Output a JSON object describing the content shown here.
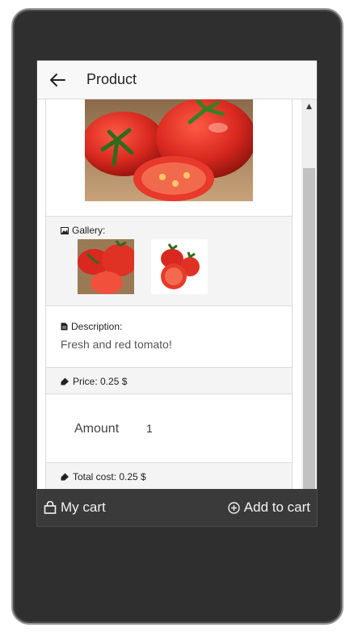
{
  "header": {
    "title": "Product"
  },
  "gallery": {
    "label": "Gallery:"
  },
  "description": {
    "label": "Description:",
    "text": "Fresh and red tomato!"
  },
  "price": {
    "label": "Price: 0.25 $"
  },
  "amount": {
    "label": "Amount",
    "value": "1"
  },
  "total": {
    "label": "Total cost: 0.25 $"
  },
  "bottombar": {
    "cart_label": "My cart",
    "add_label": "Add to cart"
  },
  "colors": {
    "frame": "#2f2f2f",
    "bottombar": "#3a3a3a",
    "tomato": "#d8281f"
  }
}
